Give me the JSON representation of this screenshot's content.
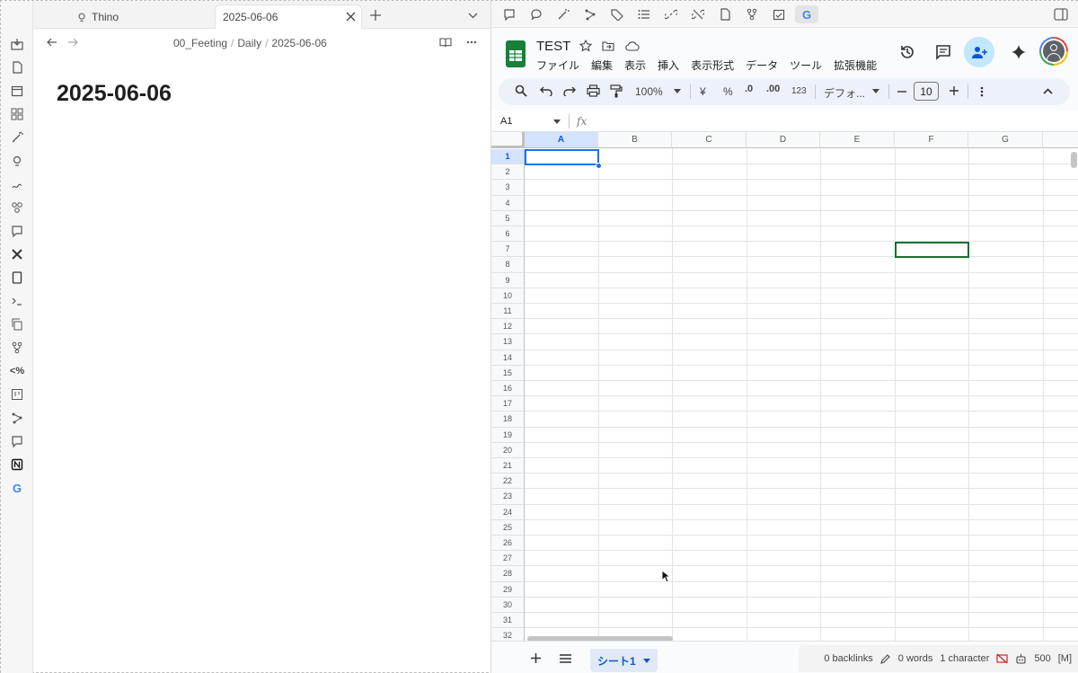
{
  "tabs": {
    "tab1_label": "Thino",
    "tab2_label": "2025-06-06"
  },
  "note": {
    "breadcrumb": [
      "00_Feeting",
      "Daily",
      "2025-06-06"
    ],
    "title": "2025-06-06"
  },
  "sheets": {
    "doc_title": "TEST",
    "menus": [
      "ファイル",
      "編集",
      "表示",
      "挿入",
      "表示形式",
      "データ",
      "ツール",
      "拡張機能"
    ],
    "zoom": "100%",
    "currency": "¥",
    "percent": "%",
    "dec_minus": ".0",
    "dec_plus": ".00",
    "number_format": "123",
    "font": "デフォ...",
    "font_size": "10",
    "name_box": "A1",
    "fx": "fx",
    "columns": [
      "A",
      "B",
      "C",
      "D",
      "E",
      "F",
      "G"
    ],
    "rows": [
      "1",
      "2",
      "3",
      "4",
      "5",
      "6",
      "7",
      "8",
      "9",
      "10",
      "11",
      "12",
      "13",
      "14",
      "15",
      "16",
      "17",
      "18",
      "19",
      "20",
      "21",
      "22",
      "23",
      "24",
      "25",
      "26",
      "27",
      "28",
      "29",
      "30",
      "31",
      "32"
    ],
    "sheet_tab": "シート1"
  },
  "status": {
    "backlinks": "0 backlinks",
    "words": "0 words",
    "characters": "1 character",
    "count": "500",
    "mode": "[M]"
  },
  "colors": {
    "accent": "#0b57d0",
    "sheets_green": "#188038",
    "selection_blue": "#1a73e8"
  }
}
